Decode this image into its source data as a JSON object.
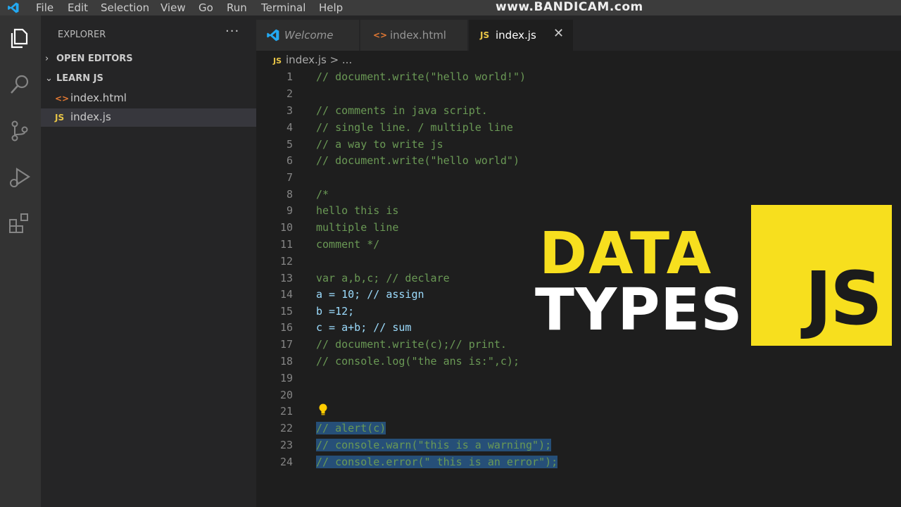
{
  "menubar": {
    "logo_icon": "vscode-logo-icon",
    "items": [
      "File",
      "Edit",
      "Selection",
      "View",
      "Go",
      "Run",
      "Terminal",
      "Help"
    ],
    "watermark": "www.BANDICAM.com"
  },
  "activitybar": {
    "icons": [
      "files-icon",
      "search-icon",
      "source-control-icon",
      "run-debug-icon",
      "extensions-icon"
    ]
  },
  "sidebar": {
    "title": "EXPLORER",
    "more": "···",
    "open_editors": "OPEN EDITORS",
    "folder": "LEARN JS",
    "files": [
      {
        "icon": "<>",
        "name": "index.html"
      },
      {
        "icon": "JS",
        "name": "index.js"
      }
    ]
  },
  "tabs": [
    {
      "label": "Welcome",
      "icon": "vscode-icon"
    },
    {
      "label": "index.html",
      "icon": "<>"
    },
    {
      "label": "index.js",
      "icon": "JS",
      "close": "✕"
    }
  ],
  "breadcrumb": {
    "icon": "JS",
    "path": "index.js > ..."
  },
  "editor": {
    "lines": [
      {
        "n": "1",
        "text": "// document.write(\"hello world!\")"
      },
      {
        "n": "2",
        "text": ""
      },
      {
        "n": "3",
        "text": "// comments in java script."
      },
      {
        "n": "4",
        "text": "// single line. / multiple line"
      },
      {
        "n": "5",
        "text": "// a way to write js"
      },
      {
        "n": "6",
        "text": "// document.write(\"hello world\")"
      },
      {
        "n": "7",
        "text": ""
      },
      {
        "n": "8",
        "text": "/*"
      },
      {
        "n": "9",
        "text": "hello this is"
      },
      {
        "n": "10",
        "text": "multiple line"
      },
      {
        "n": "11",
        "text": "comment */"
      },
      {
        "n": "12",
        "text": ""
      },
      {
        "n": "13",
        "text": "var a,b,c; // declare"
      },
      {
        "n": "14",
        "text": "a = 10; // assign"
      },
      {
        "n": "15",
        "text": "b =12;"
      },
      {
        "n": "16",
        "text": "c = a+b; // sum"
      },
      {
        "n": "17",
        "text": "// document.write(c);// print."
      },
      {
        "n": "18",
        "text": "// console.log(\"the ans is:\",c);"
      },
      {
        "n": "19",
        "text": ""
      },
      {
        "n": "20",
        "text": ""
      },
      {
        "n": "21",
        "text": ""
      },
      {
        "n": "22",
        "text": "// alert(c)"
      },
      {
        "n": "23",
        "text": "// console.warn(\"this is a warning\");"
      },
      {
        "n": "24",
        "text": "// console.error(\" this is an error\");"
      }
    ]
  },
  "overlay": {
    "title_line1": "DATA",
    "title_line2": "TYPES",
    "badge": "JS"
  },
  "colors": {
    "accent_yellow": "#f7df1e",
    "comment_green": "#6a9955",
    "selection_blue": "#264f78"
  }
}
